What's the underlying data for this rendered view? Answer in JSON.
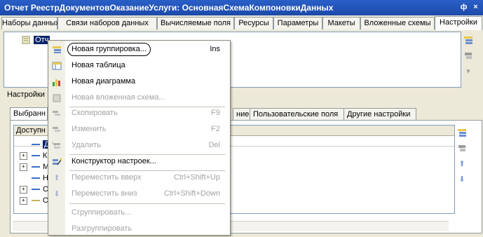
{
  "window": {
    "title": "Отчет РеестрДокументовОказаниеУслуги: ОсновнаяСхемаКомпоновкиДанных",
    "pin_label": "ф",
    "close_label": "×"
  },
  "tabs": [
    {
      "label": "Наборы данных"
    },
    {
      "label": "Связи наборов данных"
    },
    {
      "label": "Вычисляемые поля"
    },
    {
      "label": "Ресурсы"
    },
    {
      "label": "Параметры"
    },
    {
      "label": "Макеты"
    },
    {
      "label": "Вложенные схемы"
    },
    {
      "label": "Настройки"
    }
  ],
  "structure": {
    "root_label": "Отч"
  },
  "settings_label": "Настройки",
  "subtabs": [
    {
      "label": "Выбранн"
    },
    {
      "label": "ние"
    },
    {
      "label": "Пользовательские поля"
    },
    {
      "label": "Другие настройки"
    }
  ],
  "fields_grid": {
    "header": "Доступн",
    "rows": [
      {
        "label": "Д",
        "expander": "",
        "selected": true
      },
      {
        "label": "К",
        "expander": "+"
      },
      {
        "label": "М",
        "expander": "+"
      },
      {
        "label": "Н",
        "expander": ""
      },
      {
        "label": "О",
        "expander": "+"
      },
      {
        "label": "О",
        "expander": "+"
      }
    ]
  },
  "context_menu": {
    "items": [
      {
        "label": "Новая группировка...",
        "shortcut": "Ins",
        "disabled": false,
        "icon": "new-grouping-icon"
      },
      {
        "label": "Новая таблица",
        "shortcut": "",
        "disabled": false,
        "icon": "new-table-icon"
      },
      {
        "label": "Новая диаграмма",
        "shortcut": "",
        "disabled": false,
        "icon": "new-chart-icon"
      },
      {
        "label": "Новая вложенная схема...",
        "shortcut": "",
        "disabled": true,
        "icon": "nested-schema-icon"
      },
      {
        "label": "Скопировать",
        "shortcut": "F9",
        "disabled": true,
        "icon": "copy-icon"
      },
      {
        "label": "Изменить",
        "shortcut": "F2",
        "disabled": true,
        "icon": "edit-icon"
      },
      {
        "label": "Удалить",
        "shortcut": "Del",
        "disabled": true,
        "icon": "delete-icon"
      },
      {
        "label": "Конструктор настроек...",
        "shortcut": "",
        "disabled": false,
        "icon": "settings-wizard-icon"
      },
      {
        "label": "Переместить вверх",
        "shortcut": "Ctrl+Shift+Up",
        "disabled": true,
        "icon": "arrow-up-icon"
      },
      {
        "label": "Переместить вниз",
        "shortcut": "Ctrl+Shift+Down",
        "disabled": true,
        "icon": "arrow-down-icon"
      },
      {
        "label": "Сгруппировать...",
        "shortcut": "",
        "disabled": true,
        "icon": ""
      },
      {
        "label": "Разгруппировать",
        "shortcut": "",
        "disabled": true,
        "icon": ""
      }
    ]
  },
  "colors": {
    "titlebar": "#1c4aa8",
    "selection": "#0a246a",
    "accent": "#3366aa"
  }
}
